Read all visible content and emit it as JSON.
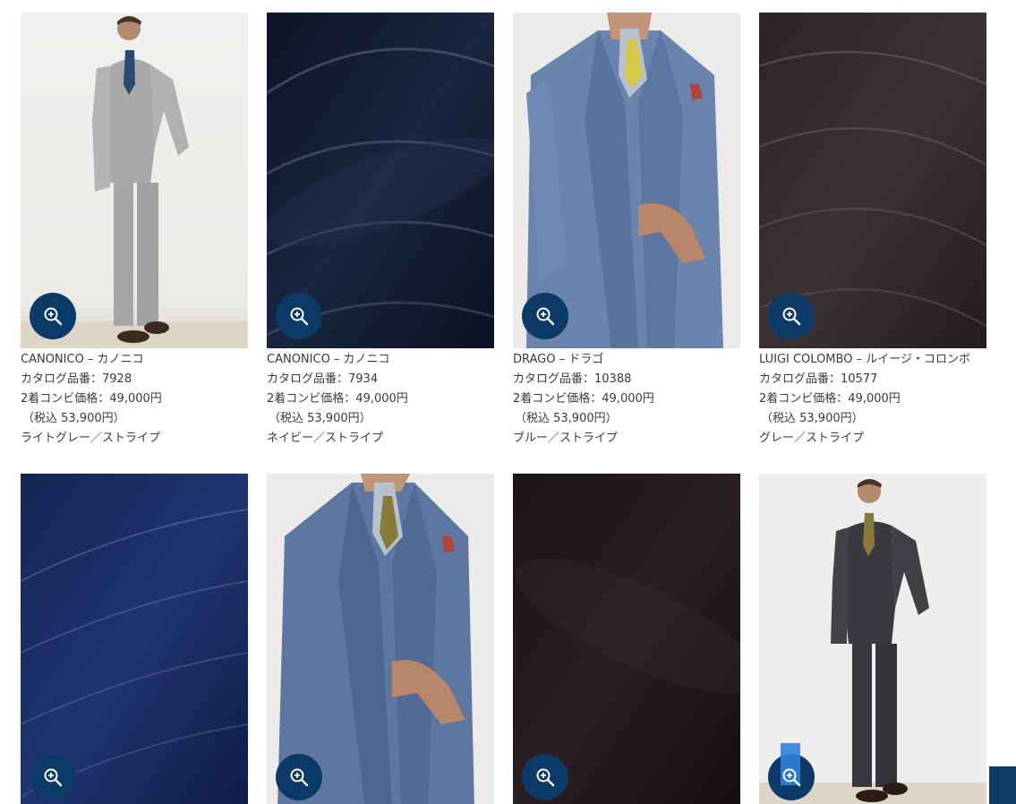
{
  "colors": {
    "zoom_button": "#0b3a66",
    "highlight": "#2f7fdc",
    "text": "#3a3a3a"
  },
  "products": [
    {
      "image": "model-light-grey-stripe-suit",
      "name": "CANONICO – カノニコ",
      "catalog": "カタログ品番：7928",
      "price": "2着コンビ価格：49,000円",
      "tax": "（税込 53,900円）",
      "color": "ライトグレー／ストライプ",
      "zoom_icon": "zoom-in-icon"
    },
    {
      "image": "navy-stripe-fabric",
      "name": "CANONICO – カノニコ",
      "catalog": "カタログ品番：7934",
      "price": "2着コンビ価格：49,000円",
      "tax": "（税込 53,900円）",
      "color": "ネイビー／ストライプ",
      "zoom_icon": "zoom-in-icon"
    },
    {
      "image": "model-blue-stripe-three-piece",
      "name": "DRAGO – ドラゴ",
      "catalog": "カタログ品番：10388",
      "price": "2着コンビ価格：49,000円",
      "tax": "（税込 53,900円）",
      "color": "ブルー／ストライプ",
      "zoom_icon": "zoom-in-icon"
    },
    {
      "image": "grey-stripe-fabric",
      "name": "LUIGI COLOMBO – ルイージ・コロンボ",
      "catalog": "カタログ品番：10577",
      "price": "2着コンビ価格：49,000円",
      "tax": "（税込 53,900円）",
      "color": "グレー／ストライプ",
      "zoom_icon": "zoom-in-icon"
    },
    {
      "image": "navy-chalk-stripe-fabric",
      "zoom_icon": "zoom-in-icon"
    },
    {
      "image": "model-blue-stripe-three-piece-closeup",
      "zoom_icon": "zoom-in-icon"
    },
    {
      "image": "dark-brown-fabric",
      "zoom_icon": "zoom-in-icon"
    },
    {
      "image": "model-charcoal-three-piece",
      "zoom_icon": "zoom-in-icon"
    }
  ]
}
